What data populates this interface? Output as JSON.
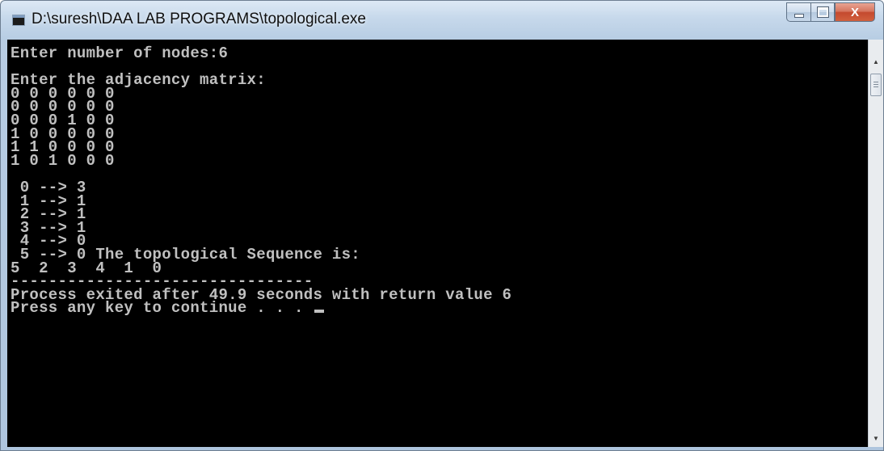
{
  "window": {
    "title": "D:\\suresh\\DAA LAB PROGRAMS\\topological.exe"
  },
  "caption": {
    "close_glyph": "X"
  },
  "console": {
    "lines": [
      "Enter number of nodes:6",
      "",
      "Enter the adjacency matrix:",
      "0 0 0 0 0 0",
      "0 0 0 0 0 0",
      "0 0 0 1 0 0",
      "1 0 0 0 0 0",
      "1 1 0 0 0 0",
      "1 0 1 0 0 0",
      "",
      " 0 --> 3",
      " 1 --> 1",
      " 2 --> 1",
      " 3 --> 1",
      " 4 --> 0",
      " 5 --> 0 The topological Sequence is:",
      "5  2  3  4  1  0",
      "--------------------------------",
      "Process exited after 49.9 seconds with return value 6",
      "Press any key to continue . . . "
    ]
  },
  "colors": {
    "console_bg": "#000000",
    "console_fg": "#c0c0c0",
    "close_button": "#c44a2e"
  },
  "icons": {
    "app": "console-app-icon",
    "minimize": "minimize-icon",
    "maximize": "maximize-icon",
    "close": "close-icon",
    "scroll_up": "scroll-up-arrow-icon",
    "scroll_down": "scroll-down-arrow-icon"
  }
}
